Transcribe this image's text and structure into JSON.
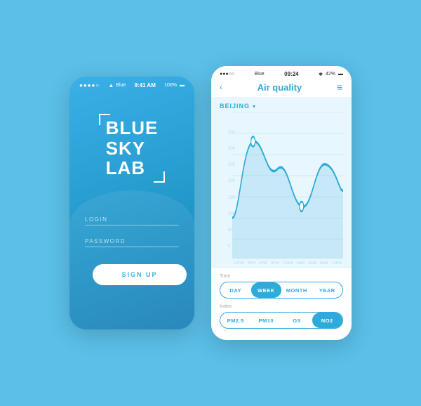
{
  "background": "#5bbfe8",
  "leftPhone": {
    "statusBar": {
      "dots": "●●●●○",
      "carrier": "Blue",
      "wifi": "📶",
      "time": "9:41 AM",
      "battery": "100%"
    },
    "logo": [
      "BLUE",
      "SKY",
      "LAB"
    ],
    "loginLabel": "LOGIN",
    "passwordLabel": "PASSWORD",
    "signupButton": "SIGN UP"
  },
  "rightPhone": {
    "statusBar": {
      "dots": "●●●○○",
      "carrier": "Blue",
      "time": "09:24",
      "bluetooth": "42%"
    },
    "navTitle": "Air quality",
    "cityName": "BEIJING",
    "yAxisLabels": [
      "350",
      "300",
      "250",
      "200",
      "150",
      "100",
      "50",
      "0"
    ],
    "xAxisLabels": [
      "12PM",
      "3PM",
      "6PM",
      "9PM",
      "12AM",
      "3AM",
      "6AM",
      "9AM",
      "12PM"
    ],
    "timeControl": {
      "label": "Time",
      "options": [
        "DAY",
        "WEEK",
        "MONTH",
        "YEAR"
      ],
      "activeOption": "WEEK"
    },
    "indexControl": {
      "label": "Index",
      "options": [
        "PM2.5",
        "PM10",
        "O3",
        "NO2"
      ],
      "activeOption": "NO2"
    }
  }
}
